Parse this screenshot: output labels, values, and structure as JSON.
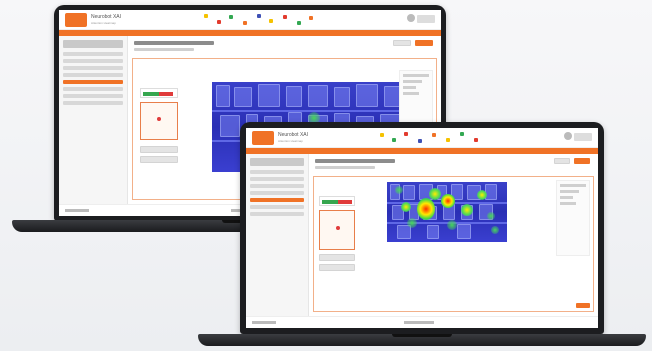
{
  "app": {
    "brand_title": "Neurobot XAI",
    "brand_subtitle": "Attention Heatmap"
  },
  "colors": {
    "accent": "#f07226",
    "heat_low": "#2a2fb5",
    "heat_mid": "#38d64a",
    "heat_high": "#ff2a00",
    "legend_good": "#36a64f",
    "legend_bad": "#e03b3b"
  },
  "icons": [
    "logo-icon",
    "user-avatar-icon",
    "settings-icon"
  ]
}
